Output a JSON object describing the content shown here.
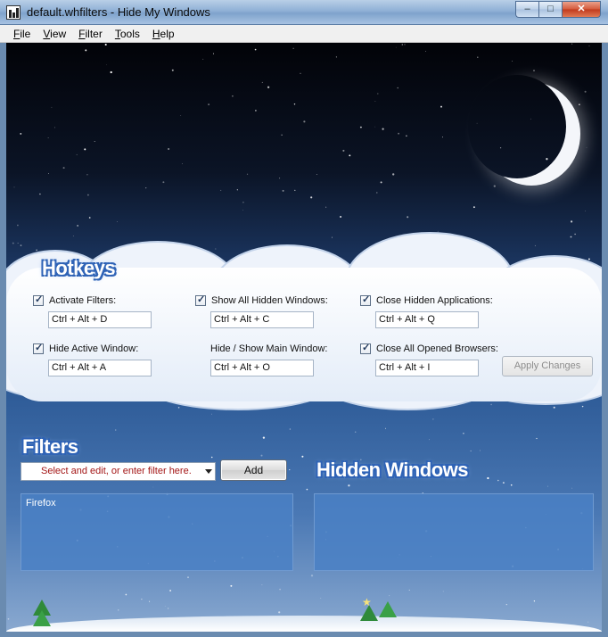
{
  "window": {
    "title": "default.whfilters - Hide My Windows",
    "minimize_glyph": "–",
    "maximize_glyph": "□",
    "close_glyph": "✕"
  },
  "menu": [
    {
      "label": "File",
      "accel": "F",
      "rest": "ile"
    },
    {
      "label": "View",
      "accel": "V",
      "rest": "iew"
    },
    {
      "label": "Filter",
      "accel": "F",
      "rest": "ilter"
    },
    {
      "label": "Tools",
      "accel": "T",
      "rest": "ools"
    },
    {
      "label": "Help",
      "accel": "H",
      "rest": "elp"
    }
  ],
  "hotkeys": {
    "title": "Hotkeys",
    "items": [
      {
        "label": "Activate Filters:",
        "checked": true,
        "value": "Ctrl + Alt + D"
      },
      {
        "label": "Show All Hidden Windows:",
        "checked": true,
        "value": "Ctrl + Alt + C"
      },
      {
        "label": "Close Hidden Applications:",
        "checked": true,
        "value": "Ctrl + Alt + Q"
      },
      {
        "label": "Hide Active Window:",
        "checked": true,
        "value": "Ctrl + Alt + A"
      },
      {
        "label": "Hide / Show Main Window:",
        "checked": false,
        "value": "Ctrl + Alt + O"
      },
      {
        "label": "Close All Opened Browsers:",
        "checked": true,
        "value": "Ctrl + Alt + I"
      }
    ],
    "apply_label": "Apply Changes"
  },
  "filters": {
    "title": "Filters",
    "placeholder": "Select and edit, or enter filter here.",
    "add_label": "Add",
    "items": [
      "Firefox"
    ]
  },
  "hidden_windows": {
    "title": "Hidden Windows",
    "items": []
  },
  "colors": {
    "accent_blue": "#2f63b6",
    "placeholder_red": "#a31515"
  },
  "icons": [
    "app-icon",
    "moon-icon",
    "checkbox-icon",
    "dropdown-arrow-icon",
    "tree-icon"
  ]
}
